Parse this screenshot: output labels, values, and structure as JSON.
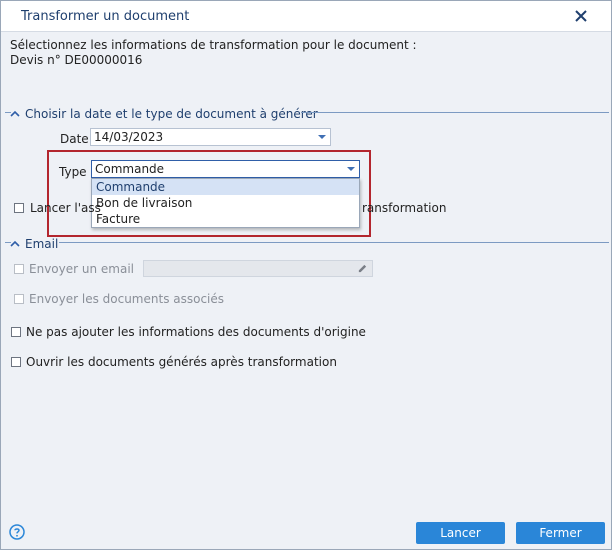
{
  "dialog": {
    "title": "Transformer un document",
    "info_line1": "Sélectionnez les informations de transformation pour le document :",
    "info_line2": "Devis n° DE00000016"
  },
  "section_dates": {
    "title": "Choisir la date et le type de document à générer",
    "date_label": "Date",
    "date_value": "14/03/2023",
    "type_label": "Type",
    "type_value": "Commande",
    "type_options": [
      "Commande",
      "Bon de livraison",
      "Facture"
    ],
    "lancer_prefix": "Lancer l'ass",
    "lancer_suffix": "ransformation"
  },
  "section_email": {
    "title": "Email",
    "send_email_label": "Envoyer un email",
    "send_docs_label": "Envoyer les documents associés"
  },
  "options": {
    "no_origin_info_label": "Ne pas ajouter les informations des documents d'origine",
    "open_generated_label": "Ouvrir les documents générés après transformation"
  },
  "footer": {
    "lancer_label": "Lancer",
    "fermer_label": "Fermer"
  },
  "colors": {
    "accent": "#2a86d8",
    "title_text": "#1f3f6e",
    "highlight_border": "#b3262e"
  }
}
